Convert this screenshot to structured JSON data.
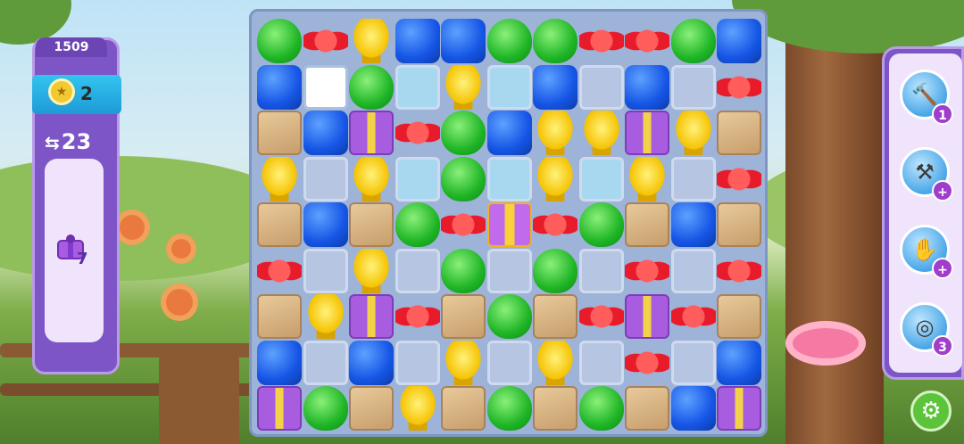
{
  "hud": {
    "score": "1509",
    "level": "2",
    "moves": "23",
    "goal_count": "7",
    "goal_icon": "purple-gift-icon"
  },
  "boosters": [
    {
      "name": "hammer-booster",
      "icon": "hammer-icon",
      "count": "1"
    },
    {
      "name": "mallet-booster",
      "icon": "mallet-icon",
      "count": "+"
    },
    {
      "name": "glove-booster",
      "icon": "glove-icon",
      "count": "+"
    },
    {
      "name": "coin-booster",
      "icon": "coin-swap-icon",
      "count": "3"
    }
  ],
  "settings_icon": "gear-icon",
  "colors": {
    "panel": "#7d55c7",
    "level_badge": "#1e9ad6",
    "board": "#9eb3d8",
    "settings": "#5bc43a"
  },
  "board": {
    "rows": [
      [
        "cup",
        "bow",
        "lamp",
        "cube",
        "cube",
        "cup",
        "cup",
        "bow",
        "bow",
        "cup",
        "cube"
      ],
      [
        "cube",
        "empty",
        "cup",
        "glass-lb",
        "lamp",
        "glass-lb",
        "cube",
        "glass",
        "cube",
        "glass",
        "bow"
      ],
      [
        "box",
        "cube",
        "gift",
        "bow",
        "cup",
        "cube",
        "lamp",
        "lamp",
        "gift",
        "lamp",
        "box"
      ],
      [
        "lamp",
        "glass",
        "lamp",
        "glass-lb",
        "cup",
        "glass-lb",
        "lamp",
        "glass-lb",
        "lamp",
        "glass",
        "bow"
      ],
      [
        "box",
        "cube",
        "box",
        "cup",
        "bow",
        "gift-big",
        "bow",
        "cup",
        "box",
        "cube",
        "box"
      ],
      [
        "bow",
        "glass",
        "lamp",
        "glass",
        "cup",
        "glass",
        "cup",
        "glass",
        "bow",
        "glass",
        "bow"
      ],
      [
        "box",
        "lamp",
        "gift",
        "bow",
        "box",
        "cup",
        "box",
        "bow",
        "gift",
        "bow",
        "box"
      ],
      [
        "cube",
        "glass",
        "cube",
        "glass",
        "lamp",
        "glass",
        "lamp",
        "glass",
        "bow",
        "glass",
        "cube"
      ],
      [
        "gift",
        "cup",
        "box",
        "lamp",
        "box",
        "cup",
        "box",
        "cup",
        "box",
        "cube",
        "gift"
      ]
    ]
  }
}
